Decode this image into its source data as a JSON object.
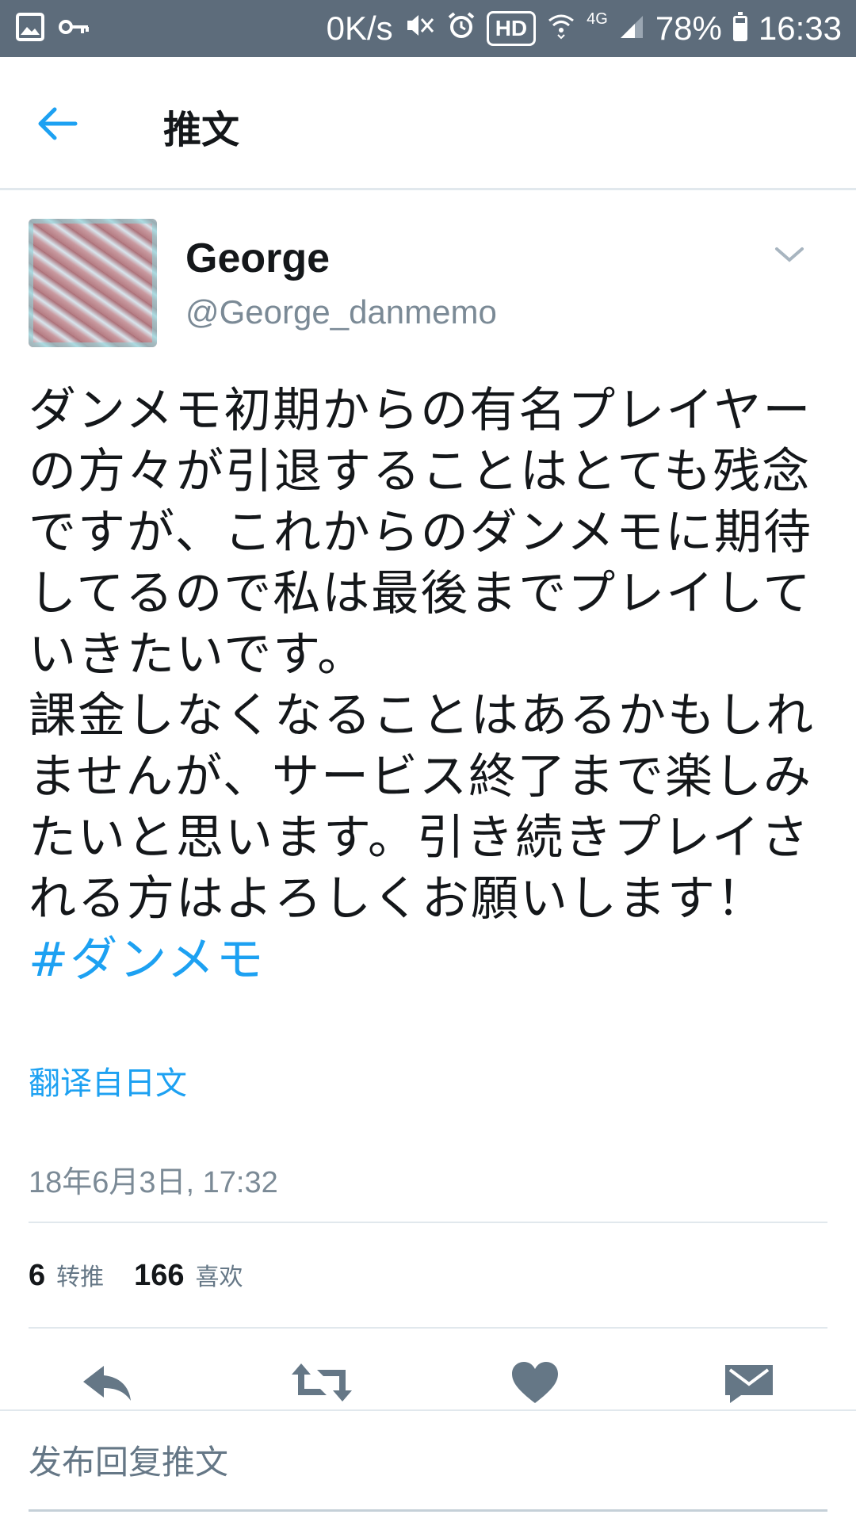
{
  "status_bar": {
    "net_speed": "0K/s",
    "hd": "HD",
    "network": "4G",
    "battery": "78%",
    "battery_level": 0.78,
    "time": "16:33"
  },
  "header": {
    "title": "推文"
  },
  "tweet": {
    "display_name": "George",
    "handle": "@George_danmemo",
    "lines": [
      "ダンメモ初期からの有名プレイヤー",
      "の方々が引退することはとても残念",
      "ですが、これからのダンメモに期待",
      "してるので私は最後までプレイして",
      "いきたいです。",
      "課金しなくなることはあるかもしれ",
      "ませんが、サービス終了まで楽しみ",
      "たいと思います。引き続きプレイさ",
      "れる方はよろしくお願いします！"
    ],
    "hashtag": "#ダンメモ",
    "translate_label": "翻译自日文",
    "timestamp": "18年6月3日, 17:32",
    "retweet_count": "6",
    "retweet_label": "转推",
    "like_count": "166",
    "like_label": "喜欢"
  },
  "reply": {
    "placeholder": "发布回复推文",
    "value": ""
  },
  "colors": {
    "status_bar": "#5d6c7b",
    "accent": "#1da1f2",
    "icon_gray": "#657786",
    "divider": "#e1e8ed"
  }
}
